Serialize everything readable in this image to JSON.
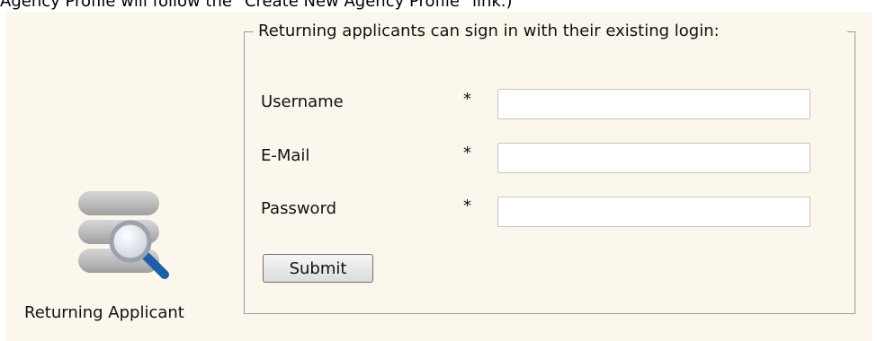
{
  "header": {
    "instruction_text": "Agency Profile will follow the \"Create New Agency Profile\" link.)"
  },
  "applicant": {
    "icon": "database-search-icon",
    "label": "Returning Applicant"
  },
  "login_form": {
    "legend": "Returning applicants can sign in with their existing login:",
    "required_marker": "*",
    "fields": [
      {
        "label": "Username",
        "value": "",
        "placeholder": ""
      },
      {
        "label": "E-Mail",
        "value": "",
        "placeholder": ""
      },
      {
        "label": "Password",
        "value": "",
        "placeholder": ""
      }
    ],
    "submit_label": "Submit"
  },
  "colors": {
    "panel_background": "#fbf7ec",
    "border": "#9a9a9a",
    "icon_accent": "#1f5fa8"
  }
}
